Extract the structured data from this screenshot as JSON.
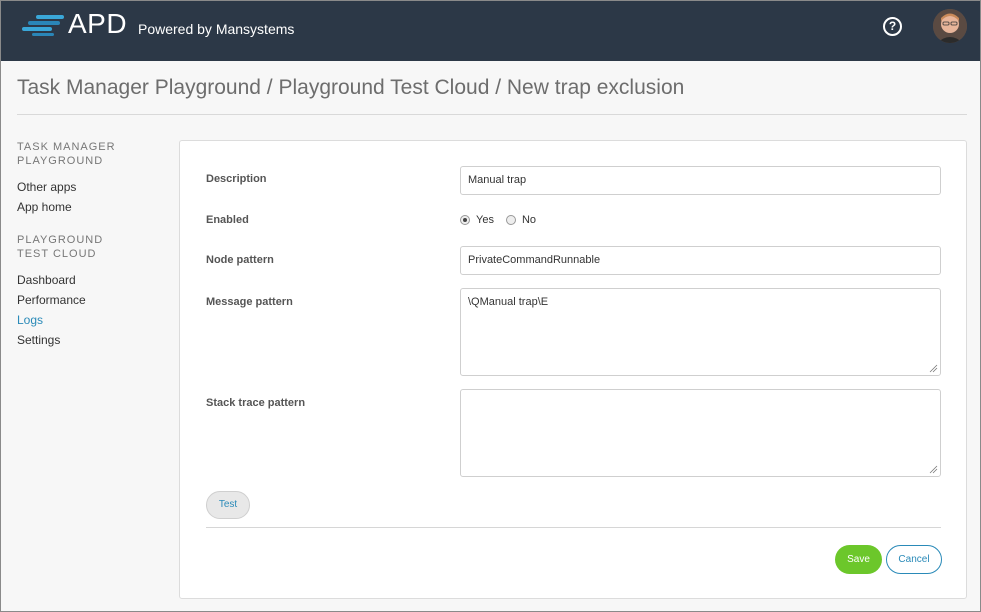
{
  "header": {
    "logo_text": "APD",
    "powered_by": "Powered by Mansystems",
    "help_icon": "question-circle-icon",
    "avatar_alt": "user-avatar"
  },
  "page": {
    "breadcrumb": "Task Manager Playground / Playground Test Cloud / New trap exclusion"
  },
  "sidebar": {
    "sections": [
      {
        "heading": "TASK MANAGER PLAYGROUND",
        "items": [
          {
            "label": "Other apps"
          },
          {
            "label": "App home"
          }
        ]
      },
      {
        "heading": "PLAYGROUND TEST CLOUD",
        "items": [
          {
            "label": "Dashboard"
          },
          {
            "label": "Performance"
          },
          {
            "label": "Logs",
            "active": true
          },
          {
            "label": "Settings"
          }
        ]
      }
    ]
  },
  "form": {
    "description": {
      "label": "Description",
      "value": "Manual trap"
    },
    "enabled": {
      "label": "Enabled",
      "yes_label": "Yes",
      "no_label": "No",
      "selected": "Yes"
    },
    "node_pattern": {
      "label": "Node pattern",
      "value": "PrivateCommandRunnable"
    },
    "message_pattern": {
      "label": "Message pattern",
      "value": "\\QManual trap\\E"
    },
    "stack_trace_pattern": {
      "label": "Stack trace pattern",
      "value": ""
    },
    "test_label": "Test",
    "save_label": "Save",
    "cancel_label": "Cancel"
  },
  "colors": {
    "topbar": "#2c3847",
    "accent": "#2a8ab8",
    "save": "#6cc72b"
  }
}
